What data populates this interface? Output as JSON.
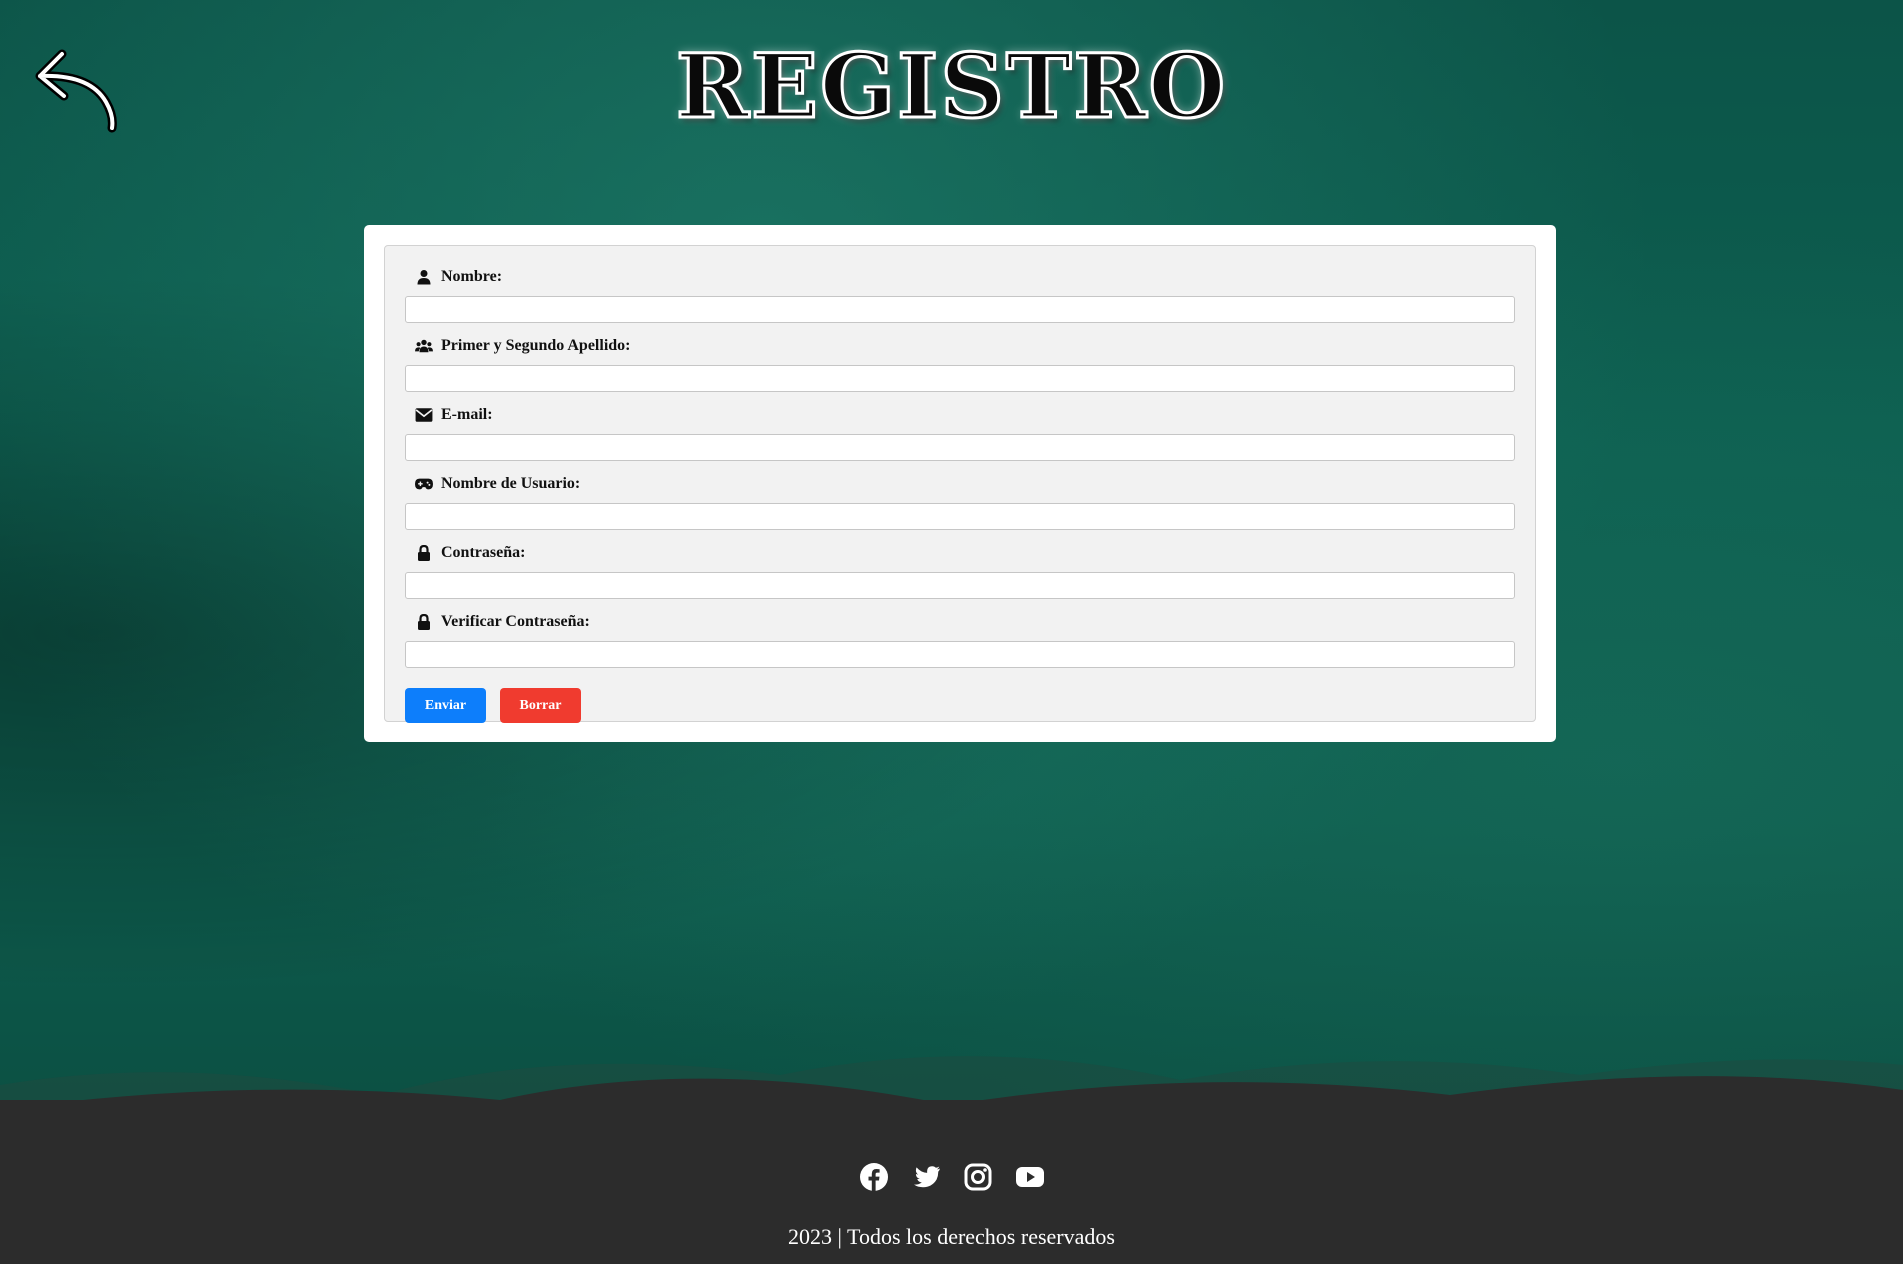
{
  "header": {
    "title": "REGISTRO",
    "back_icon": "back-arrow-icon"
  },
  "form": {
    "fields": [
      {
        "label": "Nombre:",
        "icon": "user-icon",
        "value": ""
      },
      {
        "label": "Primer y Segundo Apellido:",
        "icon": "users-icon",
        "value": ""
      },
      {
        "label": "E-mail:",
        "icon": "envelope-icon",
        "value": ""
      },
      {
        "label": "Nombre de Usuario:",
        "icon": "gamepad-icon",
        "value": ""
      },
      {
        "label": "Contraseña:",
        "icon": "lock-icon",
        "value": ""
      },
      {
        "label": "Verificar Contraseña:",
        "icon": "lock-icon",
        "value": ""
      }
    ],
    "submit_label": "Enviar",
    "reset_label": "Borrar"
  },
  "footer": {
    "social": [
      "facebook-icon",
      "twitter-icon",
      "instagram-icon",
      "youtube-icon"
    ],
    "copyright": "2023 | Todos los derechos reservados"
  },
  "colors": {
    "background": "#0d5f50",
    "footer": "#2c2c2c",
    "submit": "#0d7efb",
    "reset": "#f03b2f"
  }
}
